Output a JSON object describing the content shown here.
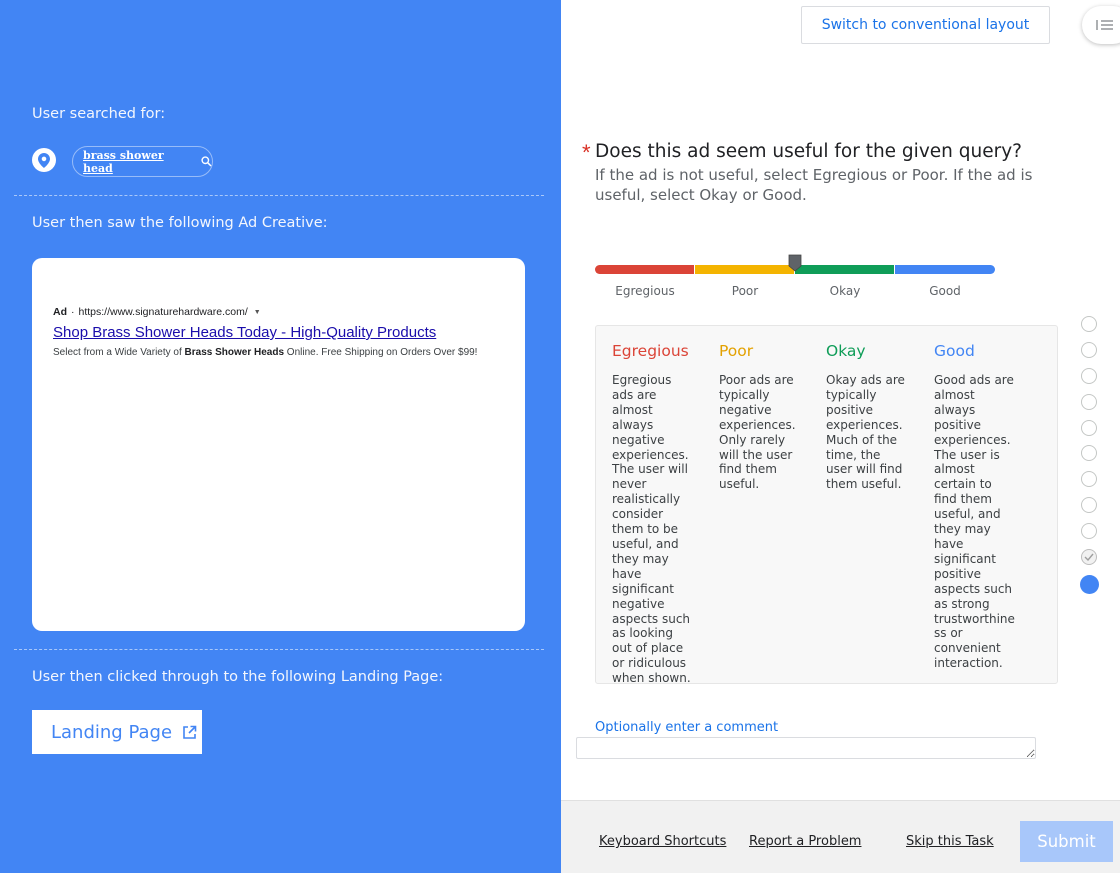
{
  "left": {
    "searched_label": "User searched for:",
    "query": "brass shower head",
    "saw_label": "User then saw the following Ad Creative:",
    "ad": {
      "badge": "Ad",
      "url": "https://www.signaturehardware.com/",
      "title": "Shop Brass Shower Heads Today - High-Quality Products",
      "desc_pre": "Select from a Wide Variety of ",
      "desc_bold": "Brass Shower Heads",
      "desc_post": " Online. Free Shipping on Orders Over $99!"
    },
    "clicked_label": "User then clicked through to the following Landing Page:",
    "landing_button": "Landing Page"
  },
  "right": {
    "switch_layout": "Switch to conventional layout",
    "question": "Does this ad seem useful for the given query?",
    "help": "If the ad is not useful, select Egregious or Poor. If the ad is useful, select Okay or Good.",
    "scale": [
      "Egregious",
      "Poor",
      "Okay",
      "Good"
    ],
    "slider_value": 2.0,
    "rubric": [
      {
        "heading": "Egregious",
        "color": "#db4437",
        "body": "Egregious ads are almost always negative experiences. The user will never realistically consider them to be useful, and they may have significant negative aspects such as looking out of place or ridiculous when shown."
      },
      {
        "heading": "Poor",
        "color": "#f4b400",
        "body": "Poor ads are typically negative experiences. Only rarely will the user find them useful."
      },
      {
        "heading": "Okay",
        "color": "#0f9d58",
        "body": "Okay ads are typically positive experiences. Much of the time, the user will find them useful."
      },
      {
        "heading": "Good",
        "color": "#4285f4",
        "body": "Good ads are almost always positive experiences. The user is almost certain to find them useful, and they may have significant positive aspects such as strong trustworthine ss or convenient interaction."
      }
    ],
    "comment_label": "Optionally enter a comment",
    "footer": {
      "shortcuts": "Keyboard Shortcuts",
      "report": "Report a Problem",
      "skip": "Skip this Task",
      "submit": "Submit"
    }
  },
  "colors": {
    "accent": "#4285f4",
    "red": "#db4437",
    "yellow": "#f4b400",
    "green": "#0f9d58"
  }
}
